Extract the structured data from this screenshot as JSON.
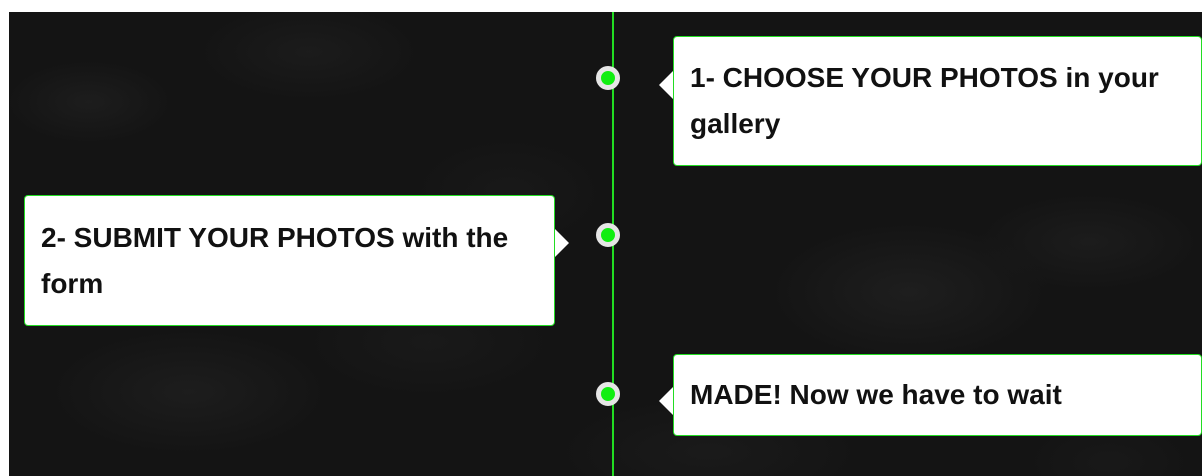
{
  "timeline": {
    "line_color": "#22dd22",
    "dot_color": "#11ee11",
    "dot_ring_color": "#e6e6e6",
    "steps": [
      {
        "text": "1- CHOOSE YOUR PHOTOS in your gallery",
        "side": "right"
      },
      {
        "text": "2- SUBMIT YOUR PHOTOS with the form",
        "side": "left"
      },
      {
        "text": "MADE! Now we have to wait",
        "side": "right"
      }
    ]
  }
}
